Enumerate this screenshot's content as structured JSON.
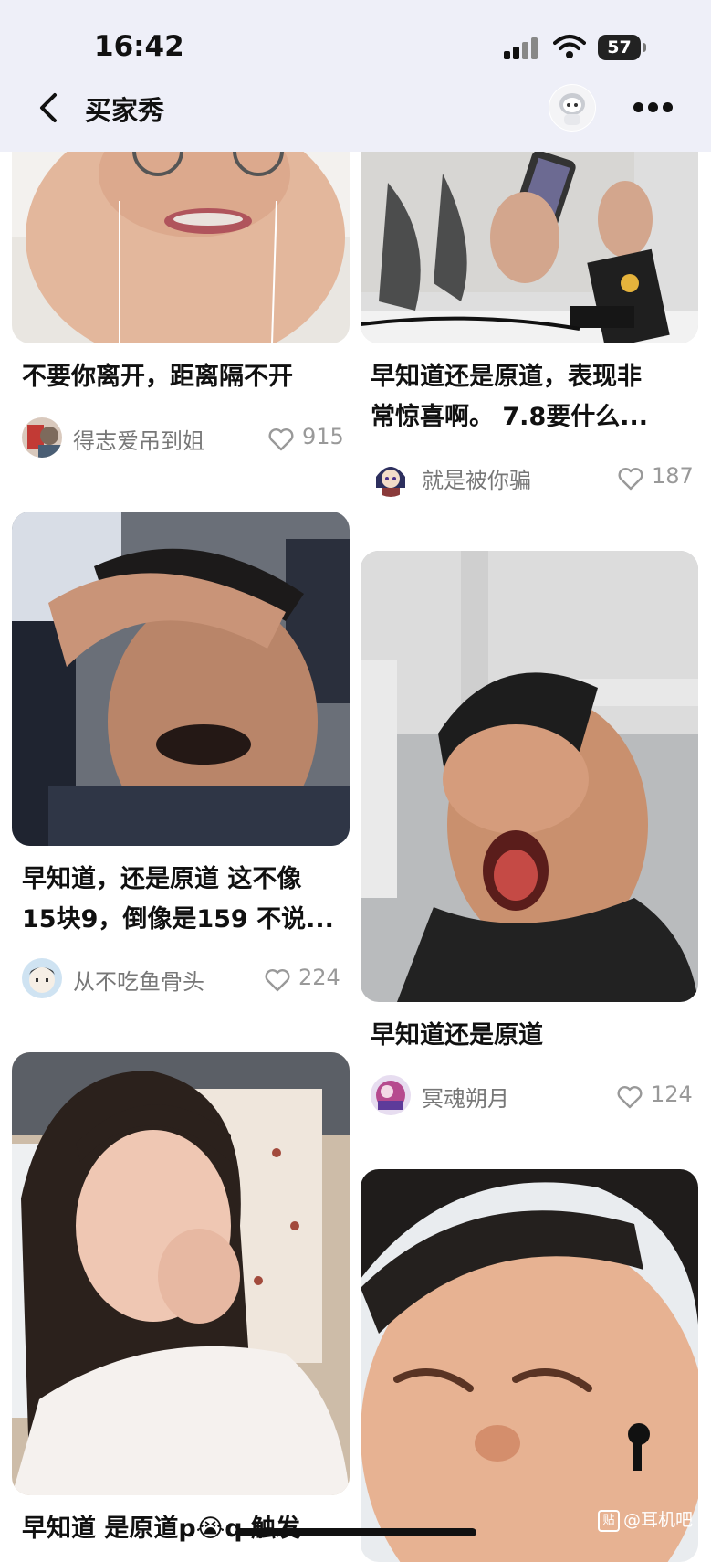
{
  "status_bar": {
    "time": "16:42",
    "battery": "57"
  },
  "nav": {
    "title": "买家秀"
  },
  "posts": [
    {
      "caption": "不要你离开，距离隔不开",
      "username": "得志爱吊到姐",
      "likes": "915"
    },
    {
      "caption": "早知道还是原道，表现非常惊喜啊。 7.8要什么...",
      "caption_line1": "早知道还是原道，表现非",
      "caption_line2": "常惊喜啊。 7.8要什么...",
      "username": "就是被你骗",
      "likes": "187"
    },
    {
      "caption_line1": "早知道，还是原道 这不像",
      "caption_line2": "15块9，倒像是159 不说...",
      "username": "从不吃鱼骨头",
      "likes": "224"
    },
    {
      "caption": "早知道还是原道",
      "username": "冥魂朔月",
      "likes": "124"
    },
    {
      "caption": "早知道 是原道p😭q 触发"
    }
  ],
  "watermark": {
    "badge": "贴",
    "text": "@耳机吧"
  },
  "icons": {
    "back": "chevron-left-icon",
    "more": "more-dots-icon",
    "heart": "heart-outline-icon",
    "avatar": "robot-avatar-icon"
  },
  "colors": {
    "topbar": "#eeeff8",
    "meta_text": "#777777"
  }
}
